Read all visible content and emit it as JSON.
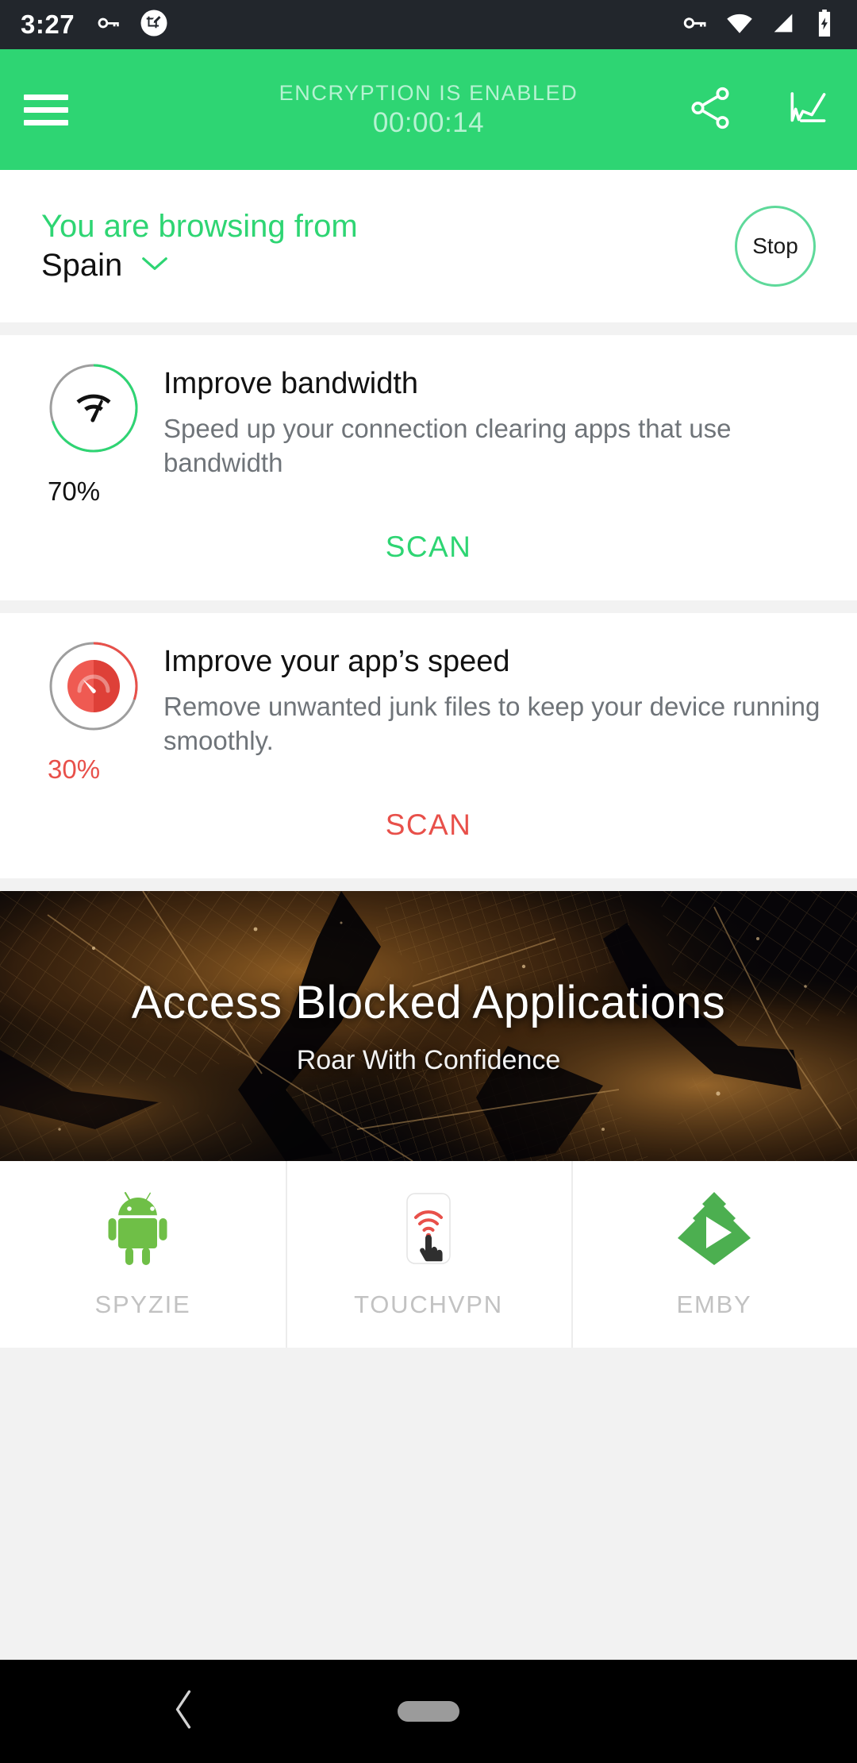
{
  "status_bar": {
    "time": "3:27",
    "left_icons": [
      "vpn-key-icon",
      "screenshot-edit-icon"
    ],
    "right_icons": [
      "vpn-key-icon",
      "wifi-icon",
      "cellular-signal-icon",
      "battery-charging-icon"
    ],
    "background_color": "#22262c"
  },
  "app_bar": {
    "menu_icon": "hamburger-menu-icon",
    "title": "ENCRYPTION IS ENABLED",
    "timer": "00:00:14",
    "share_icon": "share-icon",
    "stats_icon": "line-chart-icon",
    "background_color": "#2ed573",
    "text_color": "#b6f2d2"
  },
  "browsing": {
    "label": "You are browsing from",
    "country": "Spain",
    "chevron_icon": "chevron-down-icon",
    "stop_label": "Stop",
    "label_color": "#2ed573"
  },
  "cards": [
    {
      "title": "Improve bandwidth",
      "description": "Speed up your connection clearing apps that use bandwidth",
      "percent_label": "70%",
      "percent_value": 70,
      "scan_label": "SCAN",
      "accent_color": "#2ed573",
      "icon": "bandwidth-speed-icon",
      "track_color": "#9e9e9e"
    },
    {
      "title": "Improve your app’s speed",
      "description": "Remove unwanted junk files to keep your device running smoothly.",
      "percent_label": "30%",
      "percent_value": 30,
      "scan_label": "SCAN",
      "accent_color": "#e8504a",
      "icon": "speedometer-icon",
      "track_color": "#9e9e9e"
    }
  ],
  "banner": {
    "title": "Access Blocked Applications",
    "subtitle": "Roar With Confidence",
    "image": "night-city-aerial-photo"
  },
  "app_shortcuts": [
    {
      "label": "SPYZIE",
      "icon": "android-robot-icon",
      "color": "#6fbf47"
    },
    {
      "label": "TOUCHVPN",
      "icon": "touch-wifi-icon",
      "color": "#e8504a"
    },
    {
      "label": "EMBY",
      "icon": "emby-diamond-icon",
      "color": "#4caf50"
    }
  ],
  "nav_bar": {
    "back_icon": "back-chevron-icon",
    "home_icon": "home-pill-icon",
    "background_color": "#000000"
  }
}
